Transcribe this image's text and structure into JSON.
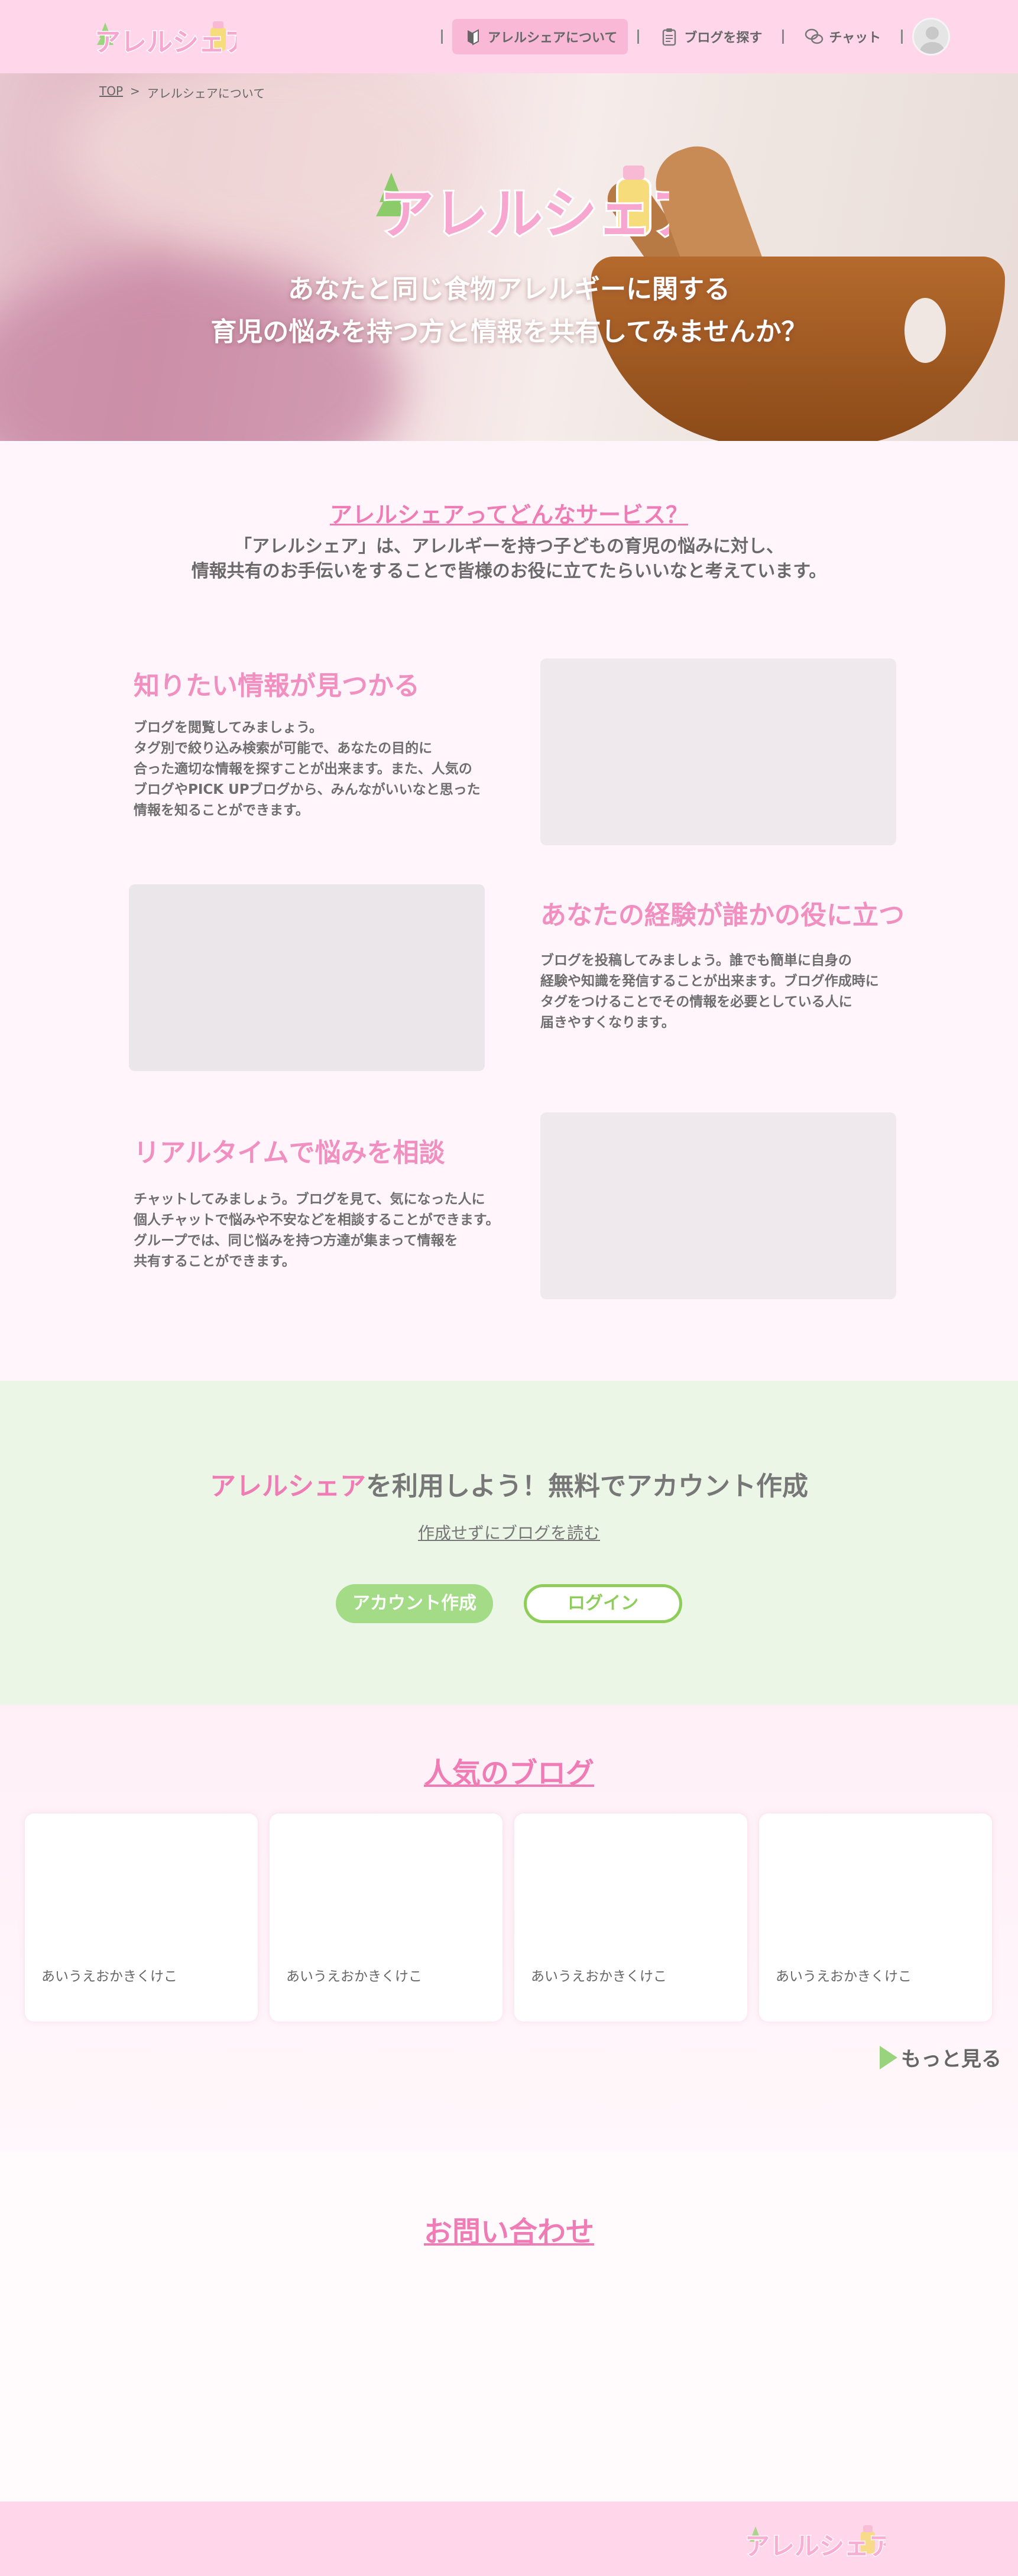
{
  "header": {
    "logo_text": "アレルシェア",
    "nav": [
      {
        "label": "アレルシェアについて",
        "icon": "beginner-icon",
        "active": true
      },
      {
        "label": "ブログを探す",
        "icon": "clipboard-icon",
        "active": false
      },
      {
        "label": "チャット",
        "icon": "chat-bubbles-icon",
        "active": false
      }
    ],
    "avatar_icon": "user-avatar-icon"
  },
  "breadcrumb": {
    "home": "TOP",
    "separator": ">",
    "current": "アレルシェアについて"
  },
  "hero": {
    "logo_text": "アレルシェア",
    "line1": "あなたと同じ食物アレルギーに関する",
    "line2": "育児の悩みを持つ方と情報を共有してみませんか？"
  },
  "about": {
    "title": "アレルシェアってどんなサービス？",
    "desc_line1": "「アレルシェア」は、アレルギーを持つ子どもの育児の悩みに対し、",
    "desc_line2": "情報共有のお手伝いをすることで皆様のお役に立てたらいいなと考えています。",
    "features": [
      {
        "title": "知りたい情報が見つかる",
        "lines": [
          "ブログを閲覧してみましょう。",
          "タグ別で絞り込み検索が可能で、あなたの目的に",
          "合った適切な情報を探すことが出来ます。また、人気の",
          "ブログやPICK UPブログから、みんながいいなと思った",
          "情報を知ることができます。"
        ]
      },
      {
        "title": "あなたの経験が誰かの役に立つ",
        "lines": [
          "ブログを投稿してみましょう。誰でも簡単に自身の",
          "経験や知識を発信することが出来ます。ブログ作成時に",
          "タグをつけることでその情報を必要としている人に",
          "届きやすくなります。"
        ]
      },
      {
        "title": "リアルタイムで悩みを相談",
        "lines": [
          "チャットしてみましょう。ブログを見て、気になった人に",
          "個人チャットで悩みや不安などを相談することができます。",
          "グループでは、同じ悩みを持つ方達が集まって情報を",
          "共有することができます。"
        ]
      }
    ]
  },
  "cta": {
    "title_brand": "アレルシェア",
    "title_rest": "を利用しよう！無料でアカウント作成",
    "read_link": "作成せずにブログを読む",
    "create_button": "アカウント作成",
    "login_button": "ログイン"
  },
  "popular": {
    "title": "人気のブログ",
    "cards": [
      {
        "label": "あいうえおかきくけこ"
      },
      {
        "label": "あいうえおかきくけこ"
      },
      {
        "label": "あいうえおかきくけこ"
      },
      {
        "label": "あいうえおかきくけこ"
      }
    ],
    "more": "もっと見る"
  },
  "contact": {
    "title": "お問い合わせ"
  },
  "footer": {
    "logo_text": "アレルシェア"
  },
  "colors": {
    "pink": "#f07cb5",
    "header_pink": "#ffd6ea",
    "green": "#a3db86",
    "green_border": "#8fcd5b",
    "cta_bg": "#ecf6e7"
  }
}
